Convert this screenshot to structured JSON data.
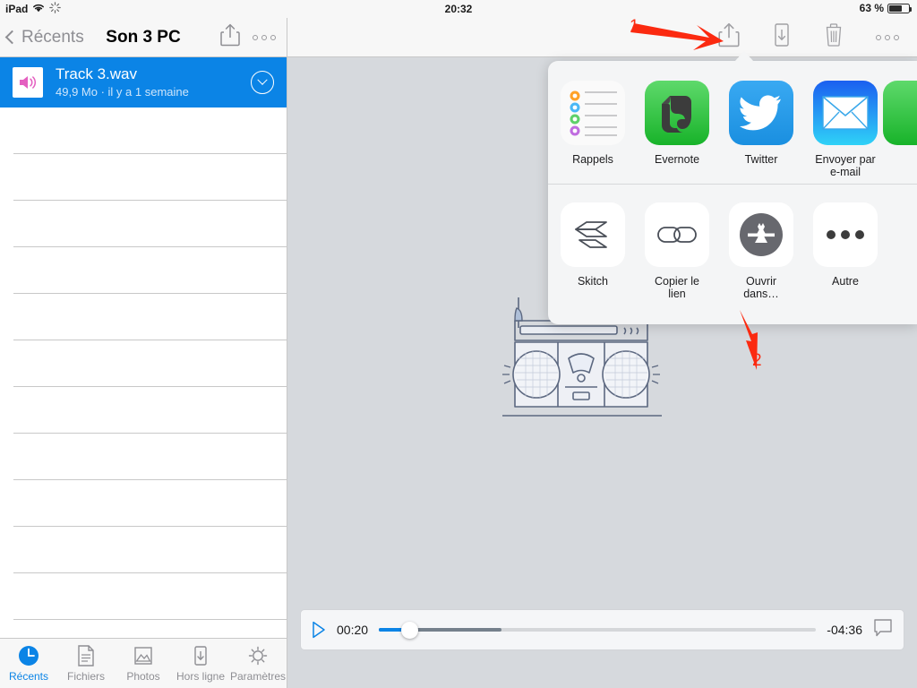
{
  "status_bar": {
    "device": "iPad",
    "wifi_icon": "wifi-icon",
    "sync_icon": "sync-activity-icon",
    "time": "20:32",
    "battery_percent": "63 %",
    "battery_icon": "battery-icon"
  },
  "sidebar": {
    "back_label": "Récents",
    "title": "Son 3 PC",
    "share_icon": "share-icon",
    "more_icon": "more-options-icon",
    "selected_file": {
      "name": "Track 3.wav",
      "details": "49,9 Mo · il y a 1 semaine",
      "type_icon": "audio-speaker-icon",
      "disclosure_icon": "chevron-down-circle-icon"
    },
    "empty_row_count": 12,
    "tabs": [
      {
        "label": "Récents",
        "icon": "clock-icon",
        "active": true
      },
      {
        "label": "Fichiers",
        "icon": "document-icon",
        "active": false
      },
      {
        "label": "Photos",
        "icon": "photo-icon",
        "active": false
      },
      {
        "label": "Hors ligne",
        "icon": "offline-download-icon",
        "active": false
      },
      {
        "label": "Paramètres",
        "icon": "gear-icon",
        "active": false
      }
    ]
  },
  "detail_toolbar": {
    "items": [
      {
        "name": "share-icon",
        "label": "Partager"
      },
      {
        "name": "save-to-device-icon",
        "label": "Enregistrer sur l'appareil"
      },
      {
        "name": "trash-icon",
        "label": "Supprimer"
      },
      {
        "name": "more-options-icon",
        "label": "Plus"
      }
    ]
  },
  "share_sheet": {
    "row1": [
      {
        "label": "Rappels",
        "icon": "reminders-icon"
      },
      {
        "label": "Evernote",
        "icon": "evernote-icon"
      },
      {
        "label": "Twitter",
        "icon": "twitter-icon"
      },
      {
        "label": "Envoyer par e-mail",
        "icon": "mail-icon"
      },
      {
        "label": "",
        "icon": "cutoff-green-app-icon"
      }
    ],
    "row2": [
      {
        "label": "Skitch",
        "icon": "skitch-icon"
      },
      {
        "label": "Copier le lien",
        "icon": "link-icon"
      },
      {
        "label": "Ouvrir dans…",
        "icon": "open-in-appstore-icon"
      },
      {
        "label": "Autre",
        "icon": "ellipsis-icon"
      }
    ]
  },
  "player": {
    "play_icon": "play-icon",
    "elapsed": "00:20",
    "remaining": "-04:36",
    "comment_icon": "comment-icon",
    "progress_percent": 7,
    "buffered_percent": 28
  },
  "annotations": [
    {
      "number": "1",
      "target": "share-icon",
      "color": "#fb2a10"
    },
    {
      "number": "2",
      "target": "open-in-appstore-icon",
      "color": "#fb2a10"
    }
  ],
  "background": {
    "illustration": "boombox-illustration"
  }
}
